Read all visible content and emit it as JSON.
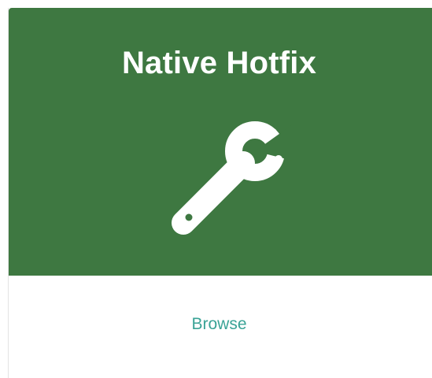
{
  "card": {
    "title": "Native Hotfix",
    "icon": "wrench-icon",
    "header_color": "#3e7841",
    "link_label": "Browse",
    "link_color": "#3aa396"
  }
}
